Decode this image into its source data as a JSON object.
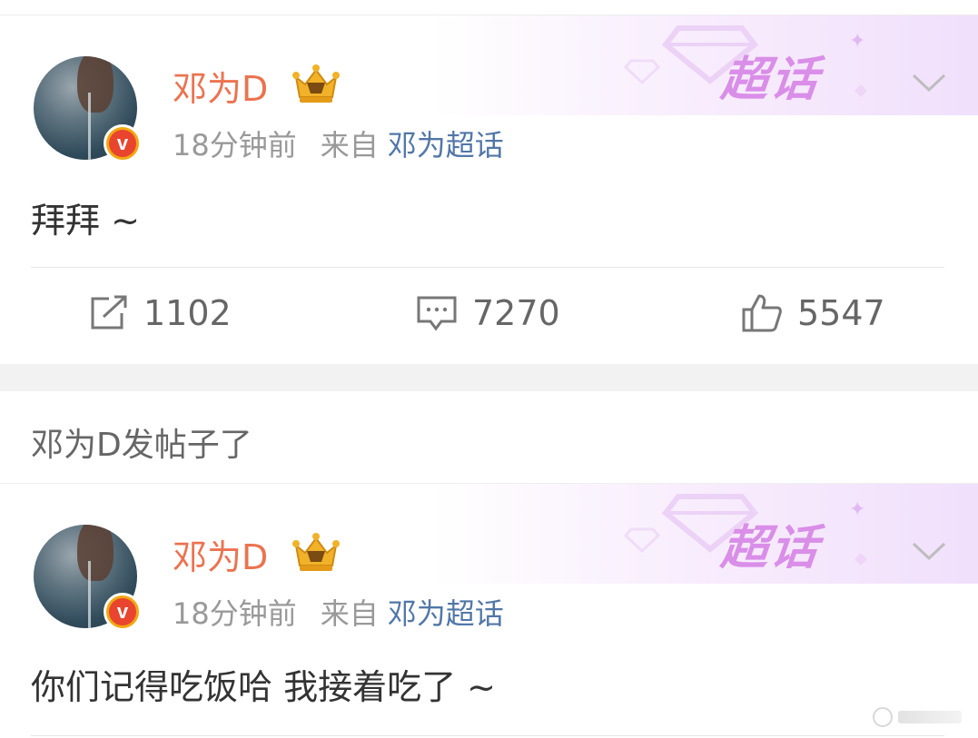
{
  "posts": [
    {
      "author": "邓为D",
      "time": "18分钟前",
      "from_label": "来自",
      "source": "邓为超话",
      "banner_label": "超话",
      "content": "拜拜 ~",
      "actions": {
        "repost": "1102",
        "comment": "7270",
        "like": "5547"
      },
      "icons": {
        "badge": "v-verified-icon",
        "crown": "crown-icon",
        "menu": "chevron-down-icon"
      }
    },
    {
      "author": "邓为D",
      "time": "18分钟前",
      "from_label": "来自",
      "source": "邓为超话",
      "banner_label": "超话",
      "content": "你们记得吃饭哈 我接着吃了 ~"
    }
  ],
  "section_header": "邓为D发帖子了",
  "colors": {
    "author": "#eb7350",
    "source_link": "#5177a8",
    "meta": "#999999",
    "chaohua": "#d98ee8",
    "verified_badge": "#e8442e"
  }
}
